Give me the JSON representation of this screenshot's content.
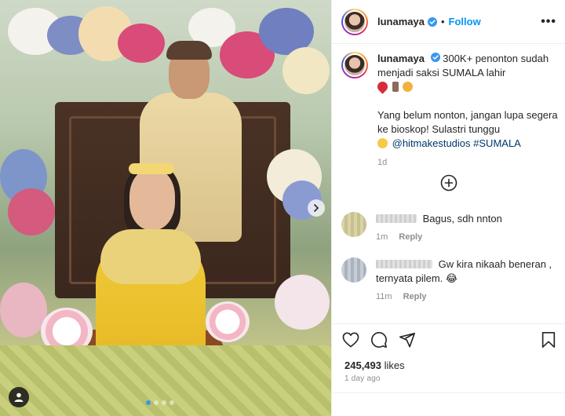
{
  "post": {
    "username": "lunamaya",
    "separator": "•",
    "follow_label": "Follow",
    "more_label": "•••",
    "caption": {
      "username": "lunamaya",
      "line1": "300K+ penonton sudah menjadi saksi SUMALA lahir",
      "line2": "Yang belum nonton, jangan lupa segera ke bioskop! Sulastri tunggu",
      "mention": "@hitmakestudios",
      "hashtag": "#SUMALA",
      "time": "1d"
    },
    "comments": [
      {
        "text": "Bagus, sdh nnton",
        "time": "1m",
        "reply_label": "Reply"
      },
      {
        "text": "Gw kira nikaah beneran , ternyata pilem. 😂",
        "time": "11m",
        "reply_label": "Reply"
      }
    ],
    "likes_count": "245,493",
    "likes_suffix": "likes",
    "date": "1 day ago"
  },
  "icons": {
    "verified": "verified-badge-icon",
    "more": "more-options-icon",
    "load_more": "plus-circle-icon",
    "like": "heart-icon",
    "comment": "comment-icon",
    "share": "send-icon",
    "save": "bookmark-icon",
    "next": "chevron-right-icon",
    "tag": "user-tag-icon"
  },
  "colors": {
    "accent": "#0095f6",
    "verified": "#3897f0",
    "text": "#262626",
    "muted": "#8e8e8e",
    "link": "#00376b"
  },
  "carousel": {
    "slides": 4,
    "active_index": 0
  }
}
